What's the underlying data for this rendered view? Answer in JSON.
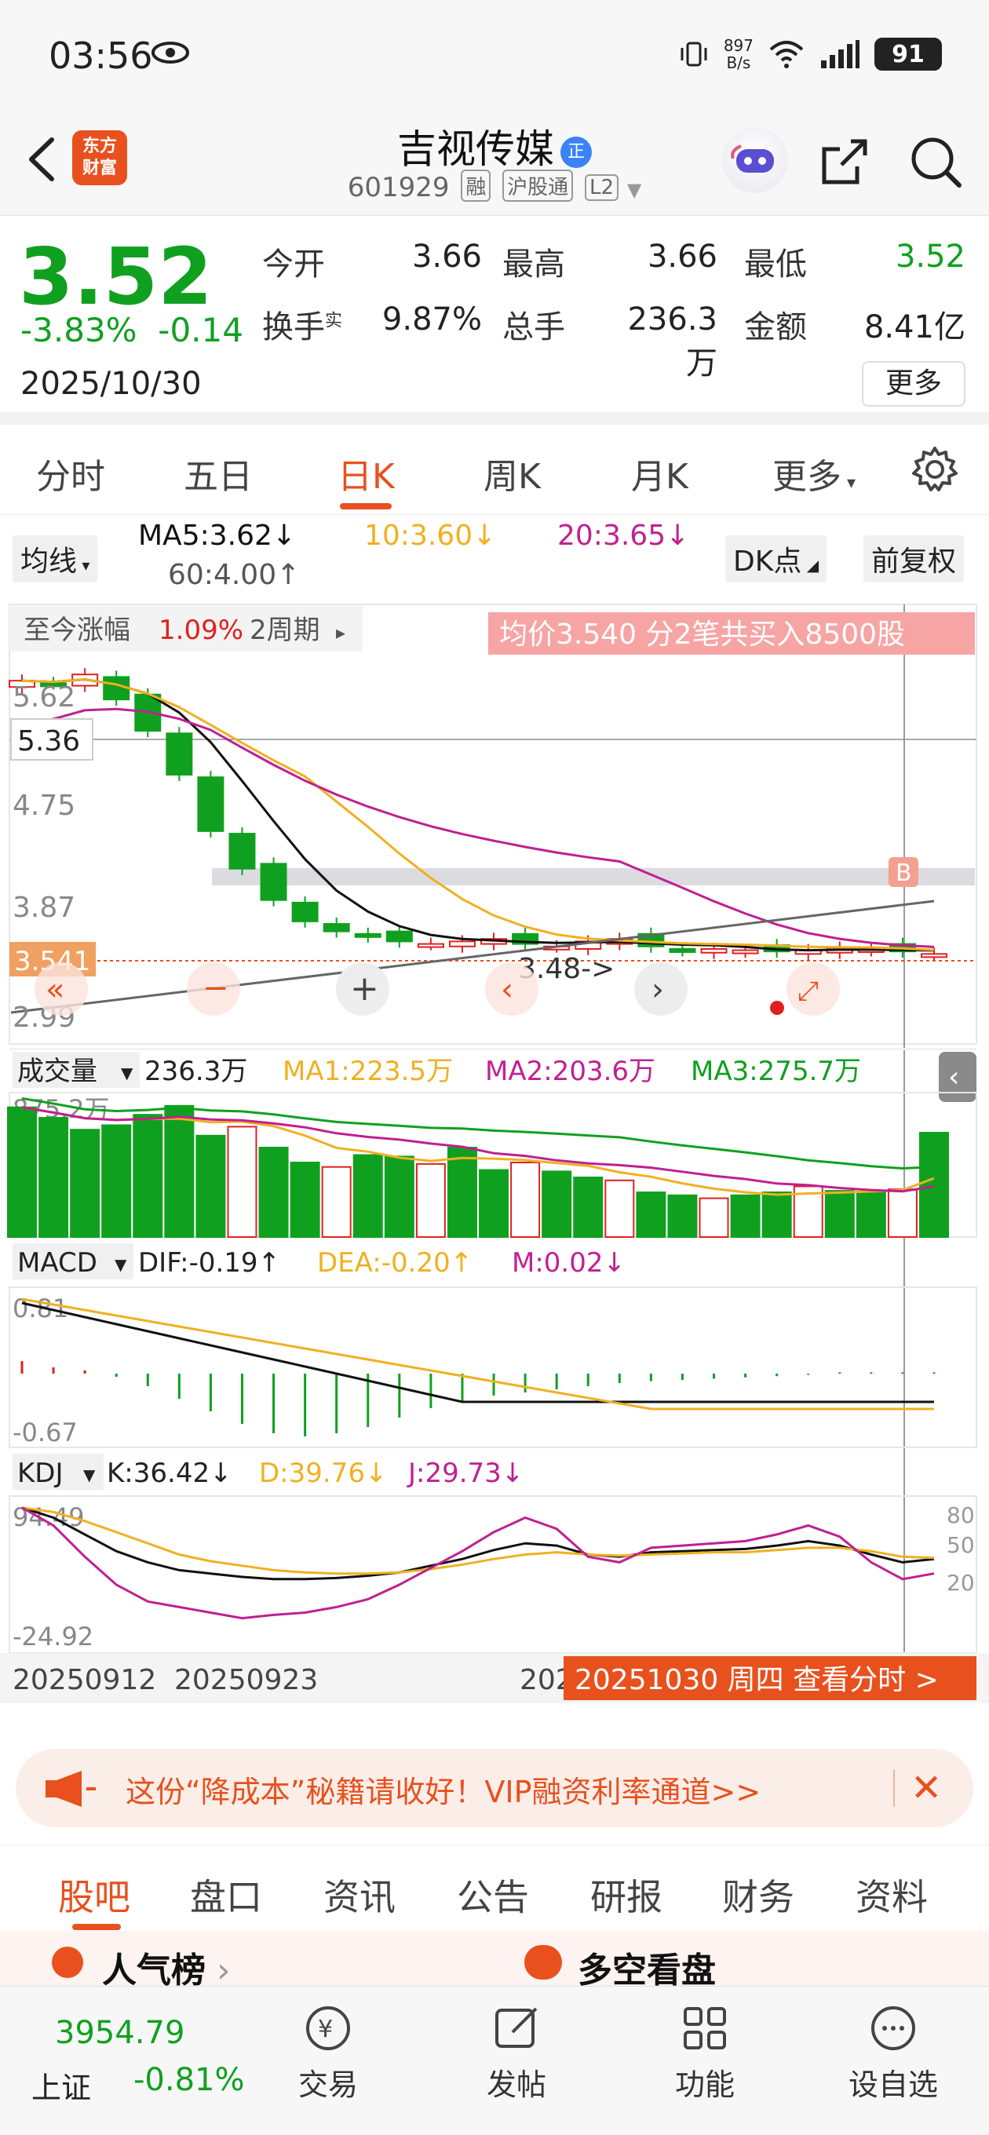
{
  "status_bar": {
    "time": "03:56",
    "net_speed_value": "897",
    "net_speed_unit": "B/s",
    "battery": "91"
  },
  "header": {
    "brand_line1": "东方",
    "brand_line2": "财富",
    "stock_name": "吉视传媒",
    "name_badge": "正",
    "code": "601929",
    "tags": [
      "融",
      "沪股通",
      "L2"
    ]
  },
  "quote": {
    "price": "3.52",
    "change_pct": "-3.83%",
    "change_abs": "-0.14",
    "date": "2025/10/30",
    "fields": [
      {
        "label": "今开",
        "value": "3.66"
      },
      {
        "label": "最高",
        "value": "3.66"
      },
      {
        "label": "最低",
        "value": "3.52"
      },
      {
        "label": "换手",
        "label_sup": "实",
        "value": "9.87%"
      },
      {
        "label": "总手",
        "value": "236.3万"
      },
      {
        "label": "金额",
        "value": "8.41亿"
      }
    ],
    "more_label": "更多"
  },
  "period_tabs": [
    "分时",
    "五日",
    "日K",
    "周K",
    "月K",
    "更多"
  ],
  "ma_row": {
    "type_select": "均线",
    "ma5": "MA5:3.62",
    "ma10": "10:3.60",
    "ma20": "20:3.65",
    "ma60": "60:4.00",
    "dk_select": "DK点",
    "adjust": "前复权"
  },
  "overlay": {
    "range_label": "至今涨幅",
    "range_pct": "1.09%",
    "range_period": "2周期",
    "buy_note": "均价3.540  分2笔共买入8500股",
    "y_labels": [
      "5.62",
      "4.75",
      "3.87",
      "2.99"
    ],
    "crosshair_price": "5.36",
    "last_price_tag": "3.541",
    "low_marker": "3.48->",
    "b_marker": "B"
  },
  "volume": {
    "select": "成交量",
    "value": "236.3万",
    "ma1": "MA1:223.5万",
    "ma2": "MA2:203.6万",
    "ma3": "MA3:275.7万",
    "max_label": "875.2万"
  },
  "macd": {
    "select": "MACD",
    "dif": "DIF:-0.19",
    "dea": "DEA:-0.20",
    "m": "M:0.02",
    "max_label": "0.81",
    "min_label": "-0.67"
  },
  "kdj": {
    "select": "KDJ",
    "k": "K:36.42",
    "d": "D:39.76",
    "j": "J:29.73",
    "max_label": "94.49",
    "min_label": "-24.92",
    "ref_levels": [
      "80",
      "50",
      "20"
    ]
  },
  "x_axis": {
    "labels": [
      "20250912",
      "20250923",
      "202"
    ],
    "cursor_label": "20251030 周四 查看分时 >"
  },
  "colors": {
    "up": "#e02020",
    "down": "#10a020",
    "accent": "#e8501e",
    "ma5": "#000000",
    "ma10": "#f0b020",
    "ma20": "#c02090",
    "ma60": "#555555"
  },
  "ad_banner": {
    "text": "这份“降成本”秘籍请收好！VIP融资利率通道>>"
  },
  "info_tabs": [
    "股吧",
    "盘口",
    "资讯",
    "公告",
    "研报",
    "财务",
    "资料"
  ],
  "peek": {
    "left": "人气榜",
    "right": "多空看盘"
  },
  "bottom_nav": {
    "index_value": "3954.79",
    "index_name": "上证",
    "index_change": "-0.81%",
    "items": [
      "交易",
      "发帖",
      "功能",
      "设自选"
    ]
  },
  "chart_data": {
    "type": "candlestick",
    "x": [
      "20250912",
      "20250923",
      "20251030"
    ],
    "ylim": [
      2.99,
      5.62
    ],
    "candles_note": "daily K-line",
    "last_close": 3.52,
    "series": [
      {
        "name": "MA5",
        "last": 3.62
      },
      {
        "name": "10",
        "last": 3.6
      },
      {
        "name": "20",
        "last": 3.65
      },
      {
        "name": "60",
        "last": 4.0
      }
    ]
  }
}
